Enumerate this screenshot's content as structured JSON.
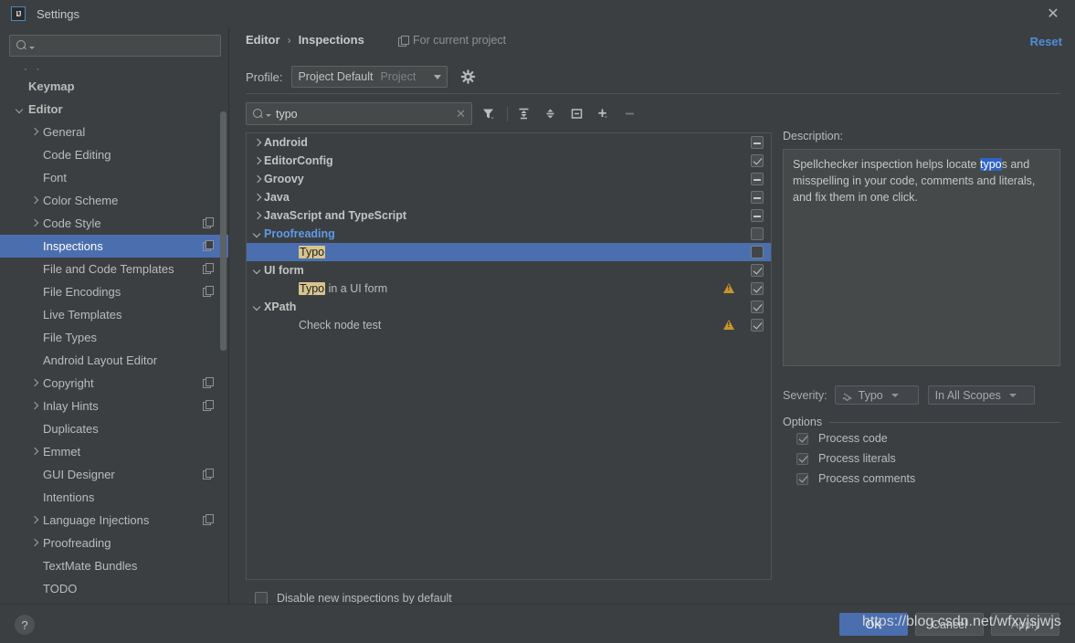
{
  "window": {
    "title": "Settings",
    "logo_text": "IJ",
    "close_icon": "close-icon"
  },
  "sidebar": {
    "search_placeholder": "",
    "search_value": "",
    "ellipsis": "· ·",
    "items": [
      {
        "label": "Keymap",
        "indent": 0,
        "arrow": "none",
        "bold": true,
        "copy": false,
        "selected": false
      },
      {
        "label": "Editor",
        "indent": 0,
        "arrow": "down",
        "bold": true,
        "copy": false,
        "selected": false
      },
      {
        "label": "General",
        "indent": 1,
        "arrow": "right",
        "bold": false,
        "copy": false,
        "selected": false
      },
      {
        "label": "Code Editing",
        "indent": 1,
        "arrow": "none",
        "bold": false,
        "copy": false,
        "selected": false
      },
      {
        "label": "Font",
        "indent": 1,
        "arrow": "none",
        "bold": false,
        "copy": false,
        "selected": false
      },
      {
        "label": "Color Scheme",
        "indent": 1,
        "arrow": "right",
        "bold": false,
        "copy": false,
        "selected": false
      },
      {
        "label": "Code Style",
        "indent": 1,
        "arrow": "right",
        "bold": false,
        "copy": true,
        "selected": false
      },
      {
        "label": "Inspections",
        "indent": 1,
        "arrow": "none",
        "bold": false,
        "copy": true,
        "selected": true
      },
      {
        "label": "File and Code Templates",
        "indent": 1,
        "arrow": "none",
        "bold": false,
        "copy": true,
        "selected": false
      },
      {
        "label": "File Encodings",
        "indent": 1,
        "arrow": "none",
        "bold": false,
        "copy": true,
        "selected": false
      },
      {
        "label": "Live Templates",
        "indent": 1,
        "arrow": "none",
        "bold": false,
        "copy": false,
        "selected": false
      },
      {
        "label": "File Types",
        "indent": 1,
        "arrow": "none",
        "bold": false,
        "copy": false,
        "selected": false
      },
      {
        "label": "Android Layout Editor",
        "indent": 1,
        "arrow": "none",
        "bold": false,
        "copy": false,
        "selected": false
      },
      {
        "label": "Copyright",
        "indent": 1,
        "arrow": "right",
        "bold": false,
        "copy": true,
        "selected": false
      },
      {
        "label": "Inlay Hints",
        "indent": 1,
        "arrow": "right",
        "bold": false,
        "copy": true,
        "selected": false
      },
      {
        "label": "Duplicates",
        "indent": 1,
        "arrow": "none",
        "bold": false,
        "copy": false,
        "selected": false
      },
      {
        "label": "Emmet",
        "indent": 1,
        "arrow": "right",
        "bold": false,
        "copy": false,
        "selected": false
      },
      {
        "label": "GUI Designer",
        "indent": 1,
        "arrow": "none",
        "bold": false,
        "copy": true,
        "selected": false
      },
      {
        "label": "Intentions",
        "indent": 1,
        "arrow": "none",
        "bold": false,
        "copy": false,
        "selected": false
      },
      {
        "label": "Language Injections",
        "indent": 1,
        "arrow": "right",
        "bold": false,
        "copy": true,
        "selected": false
      },
      {
        "label": "Proofreading",
        "indent": 1,
        "arrow": "right",
        "bold": false,
        "copy": false,
        "selected": false
      },
      {
        "label": "TextMate Bundles",
        "indent": 1,
        "arrow": "none",
        "bold": false,
        "copy": false,
        "selected": false
      },
      {
        "label": "TODO",
        "indent": 1,
        "arrow": "none",
        "bold": false,
        "copy": false,
        "selected": false
      }
    ]
  },
  "header": {
    "breadcrumb_root": "Editor",
    "breadcrumb_sep": "›",
    "breadcrumb_current": "Inspections",
    "for_current_project": "For current project",
    "reset_label": "Reset"
  },
  "profile": {
    "label": "Profile:",
    "selected_name": "Project Default",
    "selected_scope": "Project",
    "gear_icon": "gear-icon"
  },
  "toolbar": {
    "search_value": "typo",
    "search_placeholder": "",
    "clear_icon": "clear-icon",
    "buttons": [
      {
        "name": "filter-icon"
      },
      {
        "name": "expand-all-icon"
      },
      {
        "name": "collapse-all-icon"
      },
      {
        "name": "group-by-icon"
      },
      {
        "name": "add-icon"
      },
      {
        "name": "remove-icon"
      }
    ]
  },
  "tree": {
    "rows": [
      {
        "label": "Android",
        "highlight": "",
        "suffix": "",
        "indent": false,
        "arrow": "right",
        "bold": true,
        "style": "normal",
        "warn": false,
        "checkbox": "dash",
        "selected": false
      },
      {
        "label": "EditorConfig",
        "highlight": "",
        "suffix": "",
        "indent": false,
        "arrow": "right",
        "bold": true,
        "style": "normal",
        "warn": false,
        "checkbox": "check",
        "selected": false
      },
      {
        "label": "Groovy",
        "highlight": "",
        "suffix": "",
        "indent": false,
        "arrow": "right",
        "bold": true,
        "style": "normal",
        "warn": false,
        "checkbox": "dash",
        "selected": false
      },
      {
        "label": "Java",
        "highlight": "",
        "suffix": "",
        "indent": false,
        "arrow": "right",
        "bold": true,
        "style": "normal",
        "warn": false,
        "checkbox": "dash",
        "selected": false
      },
      {
        "label": "JavaScript and TypeScript",
        "highlight": "",
        "suffix": "",
        "indent": false,
        "arrow": "right",
        "bold": true,
        "style": "normal",
        "warn": false,
        "checkbox": "dash",
        "selected": false
      },
      {
        "label": "Proofreading",
        "highlight": "",
        "suffix": "",
        "indent": false,
        "arrow": "down",
        "bold": true,
        "style": "proof",
        "warn": false,
        "checkbox": "empty",
        "selected": false
      },
      {
        "label": "",
        "highlight": "Typo",
        "suffix": "",
        "indent": true,
        "arrow": "none",
        "bold": false,
        "style": "normal",
        "warn": false,
        "checkbox": "empty-sel",
        "selected": true
      },
      {
        "label": "UI form",
        "highlight": "",
        "suffix": "",
        "indent": false,
        "arrow": "down",
        "bold": true,
        "style": "normal",
        "warn": false,
        "checkbox": "check",
        "selected": false
      },
      {
        "label": "",
        "highlight": "Typo",
        "suffix": " in a UI form",
        "indent": true,
        "arrow": "none",
        "bold": false,
        "style": "normal",
        "warn": true,
        "checkbox": "check",
        "selected": false
      },
      {
        "label": "XPath",
        "highlight": "",
        "suffix": "",
        "indent": false,
        "arrow": "down",
        "bold": true,
        "style": "normal",
        "warn": false,
        "checkbox": "check",
        "selected": false
      },
      {
        "label": "Check node test",
        "highlight": "",
        "suffix": "",
        "indent": true,
        "arrow": "none",
        "bold": false,
        "style": "normal",
        "warn": true,
        "checkbox": "check",
        "selected": false
      }
    ],
    "disable_new_label": "Disable new inspections by default",
    "disable_new_checked": false
  },
  "description": {
    "label": "Description:",
    "text_before": "Spellchecker inspection helps locate ",
    "highlight": "typo",
    "text_after": "s and misspelling in your code, comments and literals, and fix them in one click."
  },
  "severity": {
    "label": "Severity:",
    "value": "Typo",
    "scope": "In All Scopes"
  },
  "options": {
    "title": "Options",
    "items": [
      {
        "label": "Process code",
        "checked": true
      },
      {
        "label": "Process literals",
        "checked": true
      },
      {
        "label": "Process comments",
        "checked": true
      }
    ]
  },
  "footer": {
    "help_label": "?",
    "ok_label": "OK",
    "cancel_label": "Cancel",
    "apply_label": "Apply",
    "watermark": "https://blog.csdn.net/wfxyjsjwjs"
  }
}
